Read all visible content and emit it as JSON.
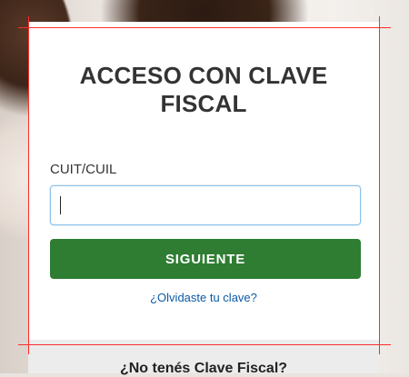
{
  "login": {
    "title_line1": "ACCESO CON CLAVE",
    "title_line2": "FISCAL",
    "cuit_label": "CUIT/CUIL",
    "input_value": "",
    "next_button": "SIGUIENTE",
    "forgot_link": "¿Olvidaste tu clave?"
  },
  "footer": {
    "no_password_text": "¿No tenés Clave Fiscal?"
  },
  "colors": {
    "primary_green": "#2e7d32",
    "link_blue": "#0b5aa8",
    "guide_red": "#ff2b2b"
  }
}
